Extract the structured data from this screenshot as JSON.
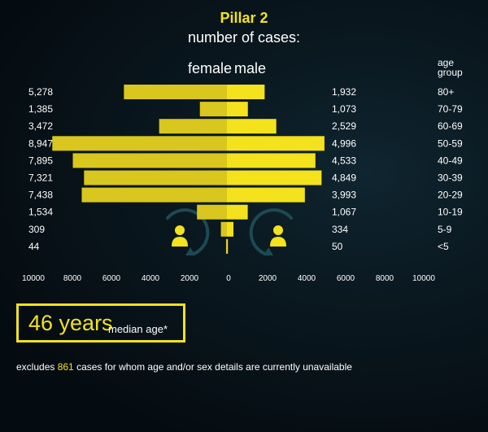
{
  "chart_data": {
    "type": "bar",
    "orientation": "horizontal-population-pyramid",
    "title": "Pillar 2",
    "subtitle": "number of cases:",
    "left_label": "female",
    "right_label": "male",
    "category_header": "age group",
    "categories": [
      "80+",
      "70-79",
      "60-69",
      "50-59",
      "40-49",
      "30-39",
      "20-29",
      "10-19",
      "5-9",
      "<5"
    ],
    "series": [
      {
        "name": "female",
        "values": [
          5278,
          1385,
          3472,
          8947,
          7895,
          7321,
          7438,
          1534,
          309,
          44
        ],
        "value_labels": [
          "5,278",
          "1,385",
          "3,472",
          "8,947",
          "7,895",
          "7,321",
          "7,438",
          "1,534",
          "309",
          "44"
        ],
        "color": "#d9c61e"
      },
      {
        "name": "male",
        "values": [
          1932,
          1073,
          2529,
          4996,
          4533,
          4849,
          3993,
          1067,
          334,
          50
        ],
        "value_labels": [
          "1,932",
          "1,073",
          "2,529",
          "4,996",
          "4,533",
          "4,849",
          "3,993",
          "1,067",
          "334",
          "50"
        ],
        "color": "#f3e21c"
      }
    ],
    "x_ticks_left": [
      "10000",
      "8000",
      "6000",
      "4000",
      "2000"
    ],
    "x_tick_zero": "0",
    "x_ticks_right": [
      "2000",
      "4000",
      "6000",
      "8000",
      "10000"
    ],
    "xlim": [
      -10000,
      10000
    ]
  },
  "median": {
    "value": "46 years",
    "label": "median age*"
  },
  "footnote": {
    "before": "excludes ",
    "count": "861",
    "after": " cases for whom age and/or sex details are currently unavailable"
  },
  "colors": {
    "accent": "#f3e21c",
    "female_bar": "#d9c61e",
    "male_bar": "#f3e21c",
    "background": "#071118",
    "icon_ring": "#1d4a52"
  },
  "icons": [
    "female-person-icon",
    "male-person-icon"
  ]
}
